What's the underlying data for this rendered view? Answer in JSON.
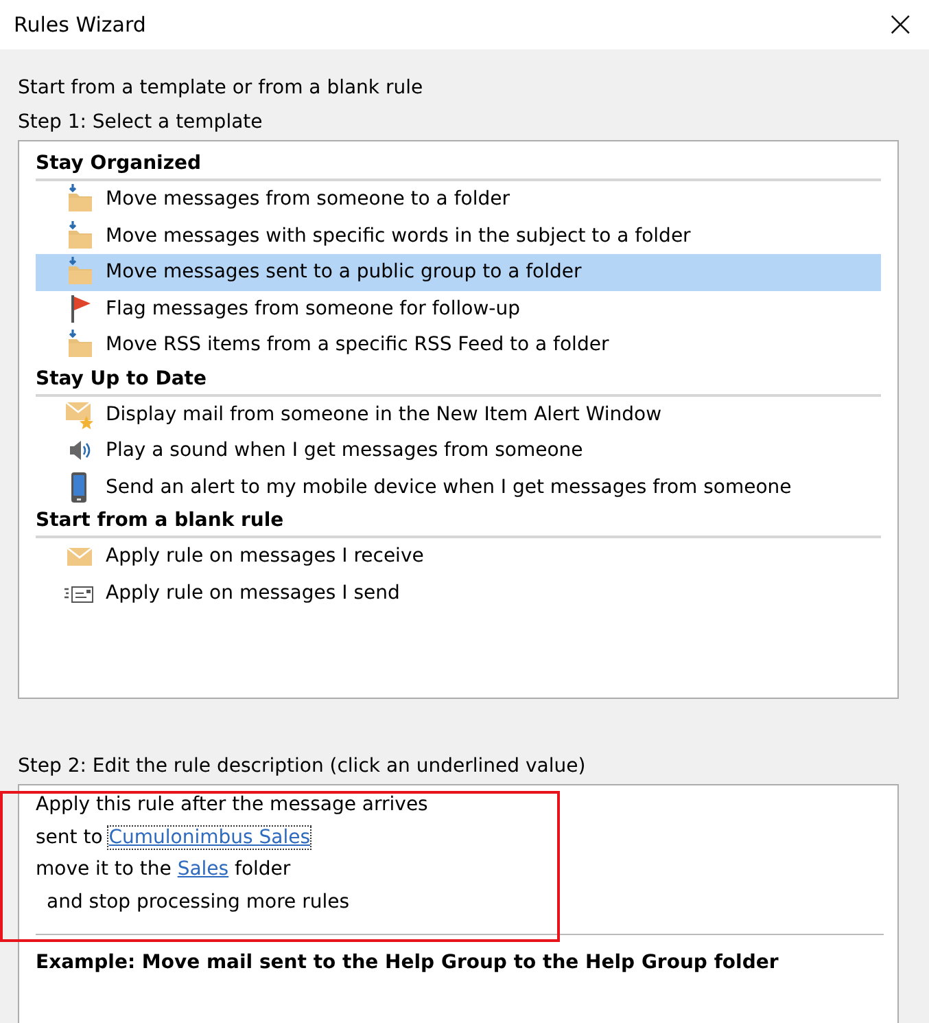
{
  "window": {
    "title": "Rules Wizard",
    "close": "×"
  },
  "intro": "Start from a template or from a blank rule",
  "step1": "Step 1: Select a template",
  "groups": [
    {
      "title": "Stay Organized",
      "items": [
        {
          "kind": "folder-move",
          "label": "Move messages from someone to a folder",
          "selected": false
        },
        {
          "kind": "folder-move",
          "label": "Move messages with specific words in the subject to a folder",
          "selected": false
        },
        {
          "kind": "folder-move",
          "label": "Move messages sent to a public group to a folder",
          "selected": true
        },
        {
          "kind": "flag",
          "label": "Flag messages from someone for follow-up",
          "selected": false
        },
        {
          "kind": "folder-move",
          "label": "Move RSS items from a specific RSS Feed to a folder",
          "selected": false
        }
      ]
    },
    {
      "title": "Stay Up to Date",
      "items": [
        {
          "kind": "mail-star",
          "label": "Display mail from someone in the New Item Alert Window",
          "selected": false
        },
        {
          "kind": "speaker",
          "label": "Play a sound when I get messages from someone",
          "selected": false
        },
        {
          "kind": "phone",
          "label": "Send an alert to my mobile device when I get messages from someone",
          "selected": false
        }
      ]
    },
    {
      "title": "Start from a blank rule",
      "items": [
        {
          "kind": "envelope",
          "label": "Apply rule on messages I receive",
          "selected": false
        },
        {
          "kind": "send-envelope",
          "label": "Apply rule on messages I send",
          "selected": false
        }
      ]
    }
  ],
  "step2": "Step 2: Edit the rule description (click an underlined value)",
  "description": {
    "highlighted": true,
    "lines": [
      {
        "indented": false,
        "parts": [
          {
            "kind": "text",
            "text": "Apply this rule after the message arrives"
          }
        ]
      },
      {
        "indented": false,
        "parts": [
          {
            "kind": "text",
            "text": "sent to "
          },
          {
            "kind": "link",
            "text": "Cumulonimbus Sales",
            "focused": true
          }
        ]
      },
      {
        "indented": false,
        "parts": [
          {
            "kind": "text",
            "text": "move it to the "
          },
          {
            "kind": "link",
            "text": "Sales",
            "focused": false
          },
          {
            "kind": "text",
            "text": " folder"
          }
        ]
      },
      {
        "indented": true,
        "parts": [
          {
            "kind": "text",
            "text": "and stop processing more rules"
          }
        ]
      }
    ],
    "example": "Example: Move mail sent to the Help Group to the Help Group folder"
  }
}
